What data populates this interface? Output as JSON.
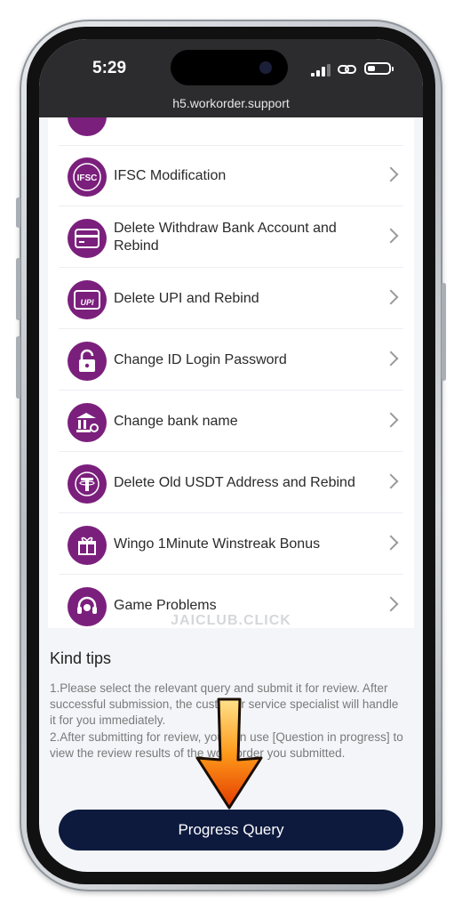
{
  "status": {
    "time": "5:29",
    "url": "h5.workorder.support"
  },
  "menu": {
    "items": [
      {
        "label": "IFSC Modification",
        "icon": "ifsc-icon"
      },
      {
        "label": "Delete Withdraw Bank Account and Rebind",
        "icon": "bank-card-icon"
      },
      {
        "label": "Delete UPI and Rebind",
        "icon": "upi-icon"
      },
      {
        "label": "Change ID Login Password",
        "icon": "unlock-icon"
      },
      {
        "label": "Change bank name",
        "icon": "bank-gear-icon"
      },
      {
        "label": "Delete Old USDT Address and Rebind",
        "icon": "tether-icon"
      },
      {
        "label": "Wingo 1Minute Winstreak Bonus",
        "icon": "gift-icon"
      },
      {
        "label": "Game Problems",
        "icon": "headset-icon"
      }
    ]
  },
  "watermark": "JAICLUB.CLICK",
  "tips": {
    "title": "Kind tips",
    "line1": "1.Please select the relevant query and submit it for review. After successful submission, the customer service specialist will handle it for you immediately.",
    "line2": "2.After submitting for review, you can use [Question in progress] to view the review results of the work order you submitted."
  },
  "footer": {
    "button_label": "Progress Query"
  },
  "colors": {
    "icon_bg": "#7b1f7d",
    "button_bg": "#0d1a3e",
    "status_bg": "#2c2c2e",
    "page_bg": "#f3f5f9"
  }
}
